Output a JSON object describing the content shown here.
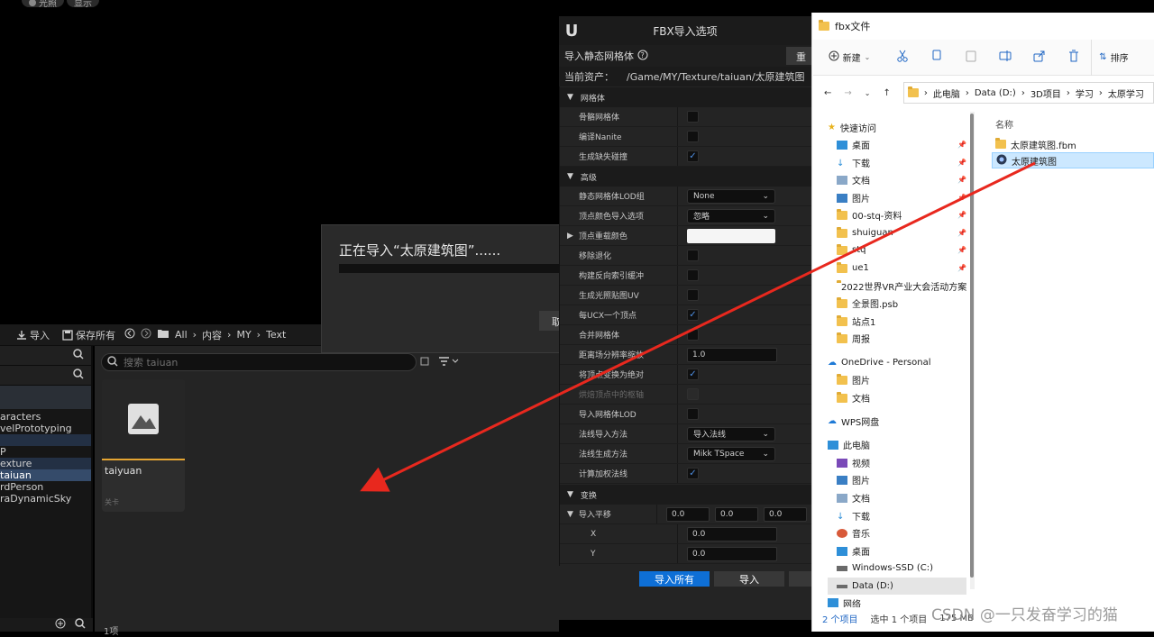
{
  "viewport": {
    "pills": [
      "光照",
      "显示"
    ]
  },
  "toolbar": {
    "import_label": "导入",
    "save_all_label": "保存所有",
    "breadcrumb": [
      "All",
      "内容",
      "MY",
      "Text"
    ]
  },
  "tree": {
    "items": [
      "aracters",
      "velPrototyping",
      "",
      "P",
      "exture",
      "taiuan",
      "rdPerson",
      "raDynamicSky"
    ]
  },
  "search": {
    "placeholder": "搜索 taiuan"
  },
  "asset": {
    "name": "taiyuan",
    "type": "关卡"
  },
  "item_count": "1项",
  "importing": {
    "text": "正在导入“太原建筑图”......",
    "cancel": "取"
  },
  "fbx": {
    "title": "FBX导入选项",
    "subtitle": "导入静态网格体",
    "reset": "重置",
    "asset_label": "当前资产：",
    "asset_path": "/Game/MY/Texture/taiuan/太原建筑图",
    "sections": {
      "mesh": "网格体",
      "advanced": "高级",
      "transform": "变换",
      "translation": "导入平移"
    },
    "rows": {
      "skeletal": "骨骼网格体",
      "nanite": "编译Nanite",
      "collision": "生成缺失碰撞",
      "lod_group": "静态网格体LOD组",
      "lod_group_value": "None",
      "vcolor": "顶点颜色导入选项",
      "vcolor_value": "忽略",
      "vcolor_override": "顶点重载颜色",
      "remove_degenerates": "移除退化",
      "reversed_index": "构建反向索引缓冲",
      "lightmap_uv": "生成光照贴图UV",
      "one_convex": "每UCX一个顶点",
      "combine": "合并网格体",
      "distance_field": "距离场分辨率缩放",
      "distance_field_value": "1.0",
      "pivot_absolute": "将顶点变换为绝对",
      "bake_pivot": "烘焙顶点中的枢轴",
      "import_lods": "导入网格体LOD",
      "normal_import": "法线导入方法",
      "normal_import_value": "导入法线",
      "normal_gen": "法线生成方法",
      "normal_gen_value": "Mikk TSpace",
      "weighted_normals": "计算加权法线",
      "x_label": "X",
      "y_label": "Y",
      "t1": "0.0",
      "t2": "0.0",
      "t3": "0.0",
      "x_value": "0.0",
      "y_value": "0.0"
    },
    "import_all": "导入所有",
    "import": "导入"
  },
  "explorer": {
    "title": "fbx文件",
    "new_label": "新建",
    "sort_label": "排序",
    "address": [
      "此电脑",
      "Data (D:)",
      "3D项目",
      "学习",
      "太原学习"
    ],
    "column_name": "名称",
    "nav": [
      "快速访问",
      "桌面",
      "下载",
      "文档",
      "图片",
      "00-stq-资料",
      "shuiguan",
      "stq",
      "ue1",
      "2022世界VR产业大会活动方案",
      "全景图.psb",
      "站点1",
      "周报",
      "OneDrive - Personal",
      "图片",
      "文档",
      "WPS网盘",
      "此电脑",
      "视频",
      "图片",
      "文档",
      "下载",
      "音乐",
      "桌面",
      "Windows-SSD (C:)",
      "Data (D:)",
      "网络"
    ],
    "files": [
      "太原建筑图.fbm",
      "太原建筑图"
    ],
    "status_count": "2 个项目",
    "status_selected": "选中 1 个项目",
    "status_size": "175 MB"
  },
  "watermark": "CSDN @一只发奋学习的猫",
  "colors": {
    "accent": "#0e6fd6",
    "arrow": "#e8281e",
    "highlight_border": "#e5a532"
  }
}
